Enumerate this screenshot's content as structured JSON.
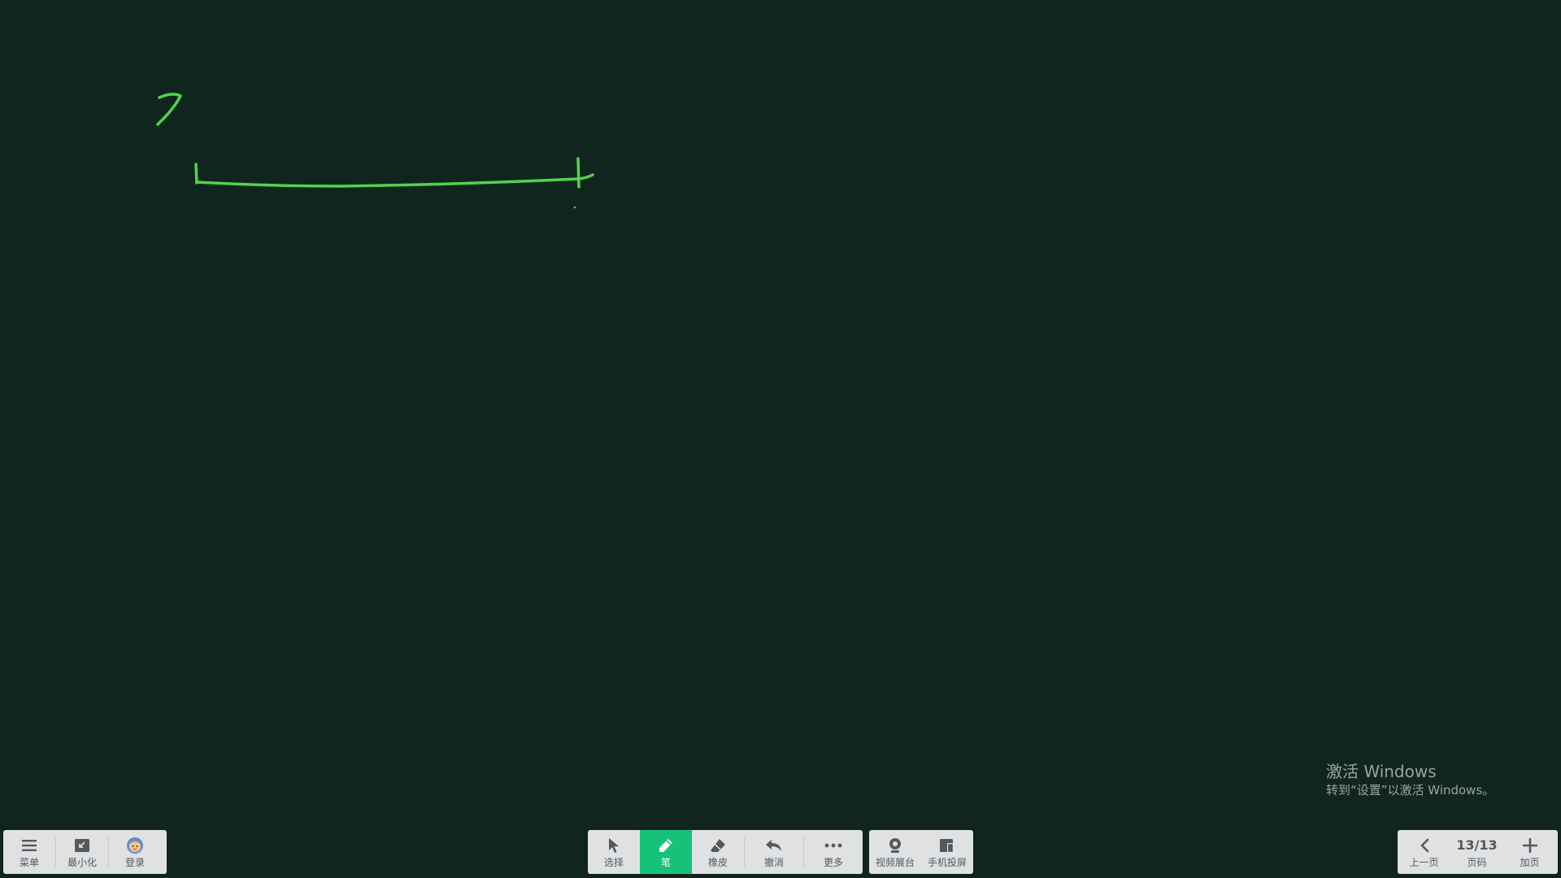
{
  "app": {
    "name": "Whiteboard",
    "stroke_color": "#4fd44c",
    "accent_color": "#16c27a",
    "background_color": "#10251e"
  },
  "left_toolbar": {
    "menu": {
      "label": "菜单",
      "icon": "hamburger-icon"
    },
    "minimize": {
      "label": "最小化",
      "icon": "minimize-icon"
    },
    "login": {
      "label": "登录",
      "icon": "avatar-icon"
    }
  },
  "center_toolbar": {
    "select": {
      "label": "选择",
      "icon": "cursor-arrow-icon"
    },
    "pen": {
      "label": "笔",
      "icon": "pen-icon",
      "active": true
    },
    "eraser": {
      "label": "橡皮",
      "icon": "eraser-icon"
    },
    "undo": {
      "label": "撤消",
      "icon": "undo-icon"
    },
    "more": {
      "label": "更多",
      "icon": "ellipsis-icon"
    }
  },
  "media_toolbar": {
    "video_booth": {
      "label": "视频展台",
      "icon": "camera-icon"
    },
    "phone_cast": {
      "label": "手机投屏",
      "icon": "phone-cast-icon"
    }
  },
  "page_toolbar": {
    "prev": {
      "label": "上一页",
      "icon": "chevron-left-icon"
    },
    "page": {
      "value": "13/13",
      "label": "页码"
    },
    "add": {
      "label": "加页",
      "icon": "plus-icon"
    }
  },
  "watermark": {
    "title": "激活 Windows",
    "subtitle": "转到“设置”以激活 Windows。"
  }
}
